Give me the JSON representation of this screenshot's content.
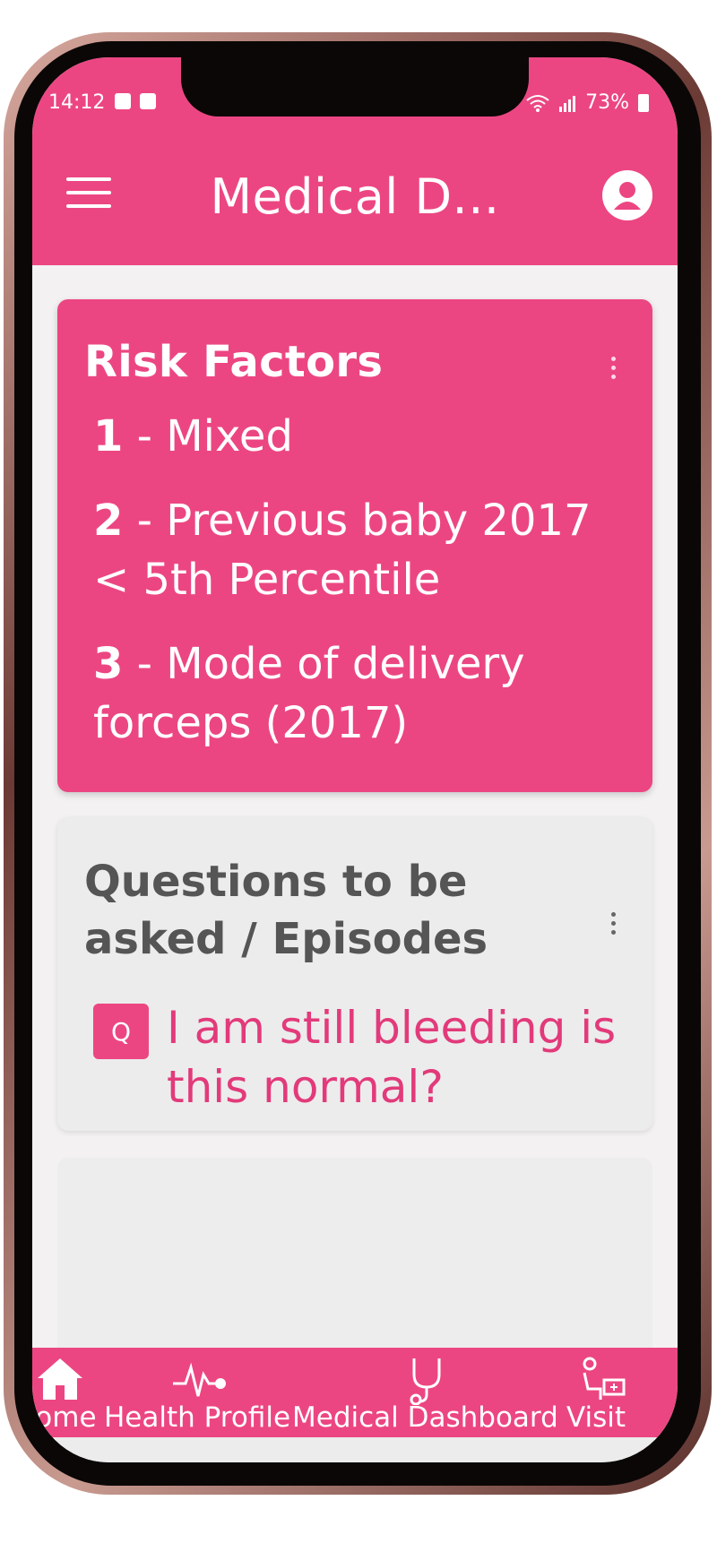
{
  "status_bar": {
    "time": "14:12",
    "battery": "73%"
  },
  "app_bar": {
    "title": "Medical D..."
  },
  "risk_card": {
    "title": "Risk Factors",
    "items": [
      {
        "number": "1",
        "text": "Mixed"
      },
      {
        "number": "2",
        "text": "Previous baby 2017 < 5th Percentile"
      },
      {
        "number": "3",
        "text": "Mode of delivery forceps (2017)"
      }
    ]
  },
  "questions_card": {
    "title": "Questions to be asked / Episodes",
    "badge": "Q",
    "question": "I am still bleeding is this normal?"
  },
  "bottom_nav": {
    "items": [
      {
        "label": "Home",
        "icon": "home-icon"
      },
      {
        "label": "Health Profile",
        "icon": "heartbeat-icon"
      },
      {
        "label": "Medical Dashboard",
        "icon": "stethoscope-icon"
      },
      {
        "label": "Visit",
        "icon": "visit-icon"
      }
    ]
  },
  "colors": {
    "primary": "#ec4682",
    "question_text": "#e23a7a",
    "card_bg": "#ececec",
    "heading_gray": "#555555"
  }
}
